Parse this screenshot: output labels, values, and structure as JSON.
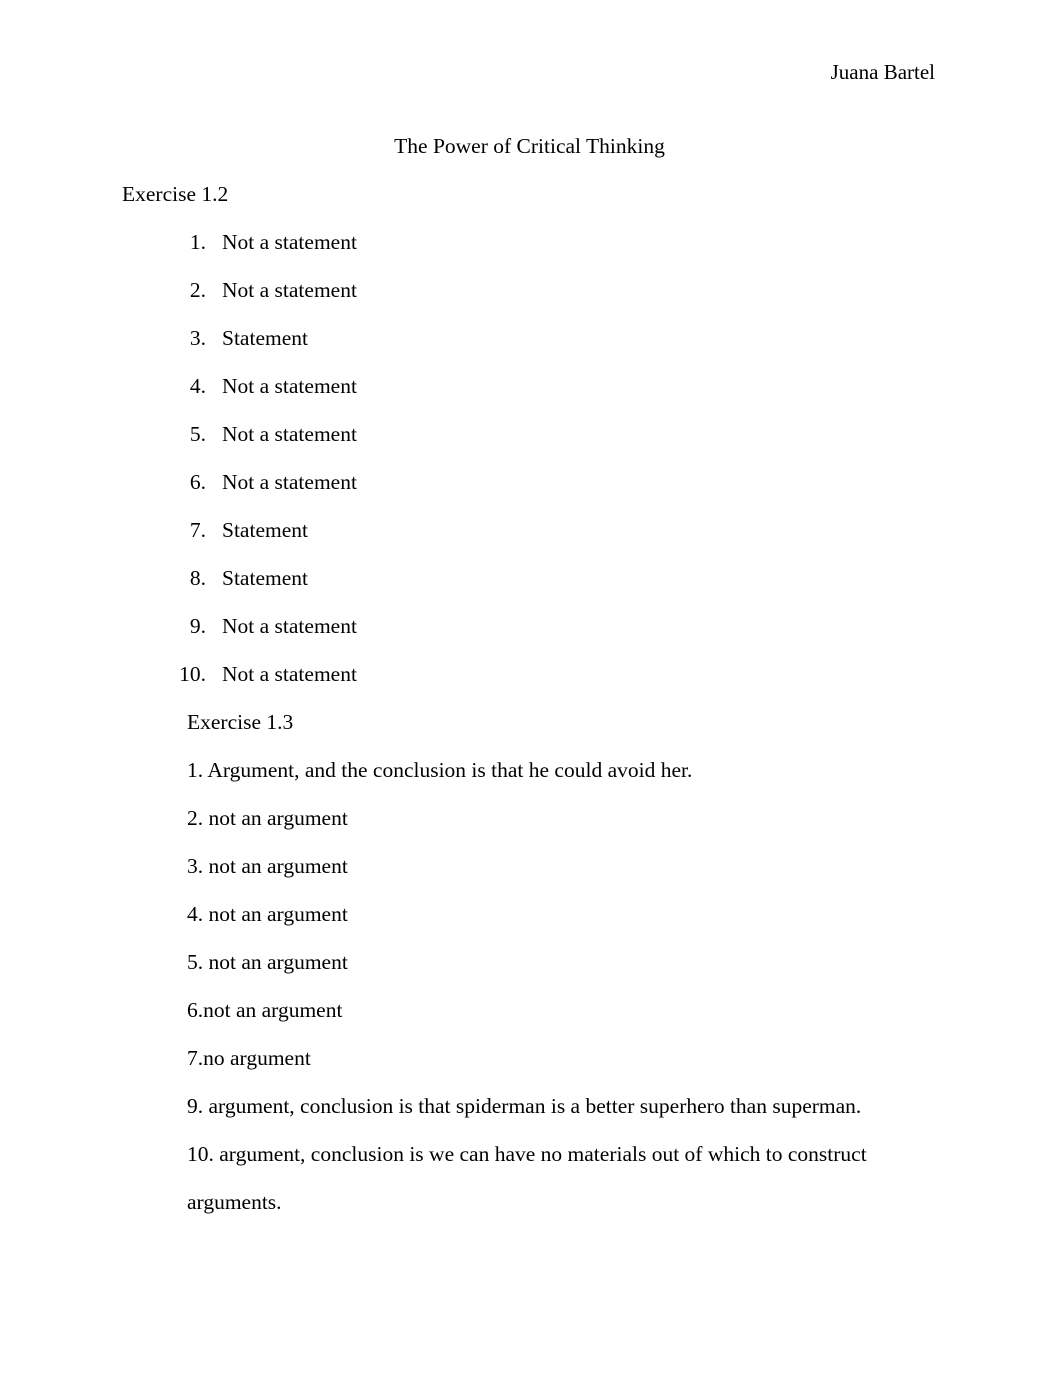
{
  "document": {
    "header_name": "Juana Bartel",
    "title": "The Power of Critical Thinking",
    "sections": [
      {
        "heading": "Exercise 1.2",
        "style": "numbered",
        "items": [
          {
            "num": "1.",
            "text": "Not a statement"
          },
          {
            "num": "2.",
            "text": "Not a statement"
          },
          {
            "num": "3.",
            "text": "Statement"
          },
          {
            "num": "4.",
            "text": "Not a statement"
          },
          {
            "num": "5.",
            "text": "Not a statement"
          },
          {
            "num": "6.",
            "text": "Not a statement"
          },
          {
            "num": "7.",
            "text": "Statement"
          },
          {
            "num": "8.",
            "text": "Statement"
          },
          {
            "num": "9.",
            "text": "Not a statement"
          },
          {
            "num": "10.",
            "text": "Not a statement"
          }
        ]
      },
      {
        "heading": "Exercise 1.3",
        "style": "plain",
        "items": [
          {
            "text": "1. Argument, and the conclusion is that he could avoid her."
          },
          {
            "text": "2. not an argument"
          },
          {
            "text": "3. not an argument"
          },
          {
            "text": "4. not an argument"
          },
          {
            "text": "5. not an argument"
          },
          {
            "text": "6.not an argument"
          },
          {
            "text": "7.no argument"
          },
          {
            "text": "9. argument, conclusion is that spiderman is a better superhero than superman."
          },
          {
            "text": "10. argument, conclusion is we can have no materials out of which to construct arguments."
          }
        ]
      }
    ]
  },
  "colors": {
    "page_background": "#ffffff",
    "text": "#000000"
  }
}
